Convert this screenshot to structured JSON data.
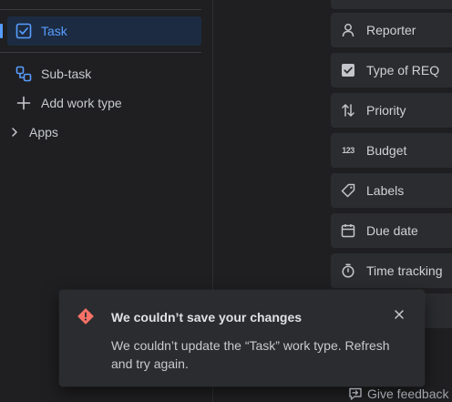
{
  "sidebar": {
    "items": [
      {
        "label": "Task",
        "icon": "checkbox-icon",
        "selected": true
      },
      {
        "label": "Sub-task",
        "icon": "subtask-icon"
      },
      {
        "label": "Add work type",
        "icon": "plus-icon"
      },
      {
        "label": "Apps",
        "icon": "chevron-right-icon"
      }
    ]
  },
  "fields": [
    {
      "label": "Reporter",
      "icon": "person-icon"
    },
    {
      "label": "Type of REQ",
      "icon": "checkbox-filled-icon"
    },
    {
      "label": "Priority",
      "icon": "sort-arrows-icon"
    },
    {
      "label": "Budget",
      "icon": "number-icon",
      "icon_text": "123"
    },
    {
      "label": "Labels",
      "icon": "tag-icon"
    },
    {
      "label": "Due date",
      "icon": "calendar-icon"
    },
    {
      "label": "Time tracking",
      "icon": "stopwatch-icon"
    }
  ],
  "toast": {
    "title": "We couldn’t save your changes",
    "message": "We couldn’t update the “Task” work type. Refresh and try again.",
    "icon": "error-diamond-icon",
    "error_color": "#f87168"
  },
  "footer": {
    "feedback_label": "Give feedback"
  },
  "colors": {
    "accent": "#579dff",
    "background": "#1f1f21",
    "surface": "#2b2c2f"
  }
}
